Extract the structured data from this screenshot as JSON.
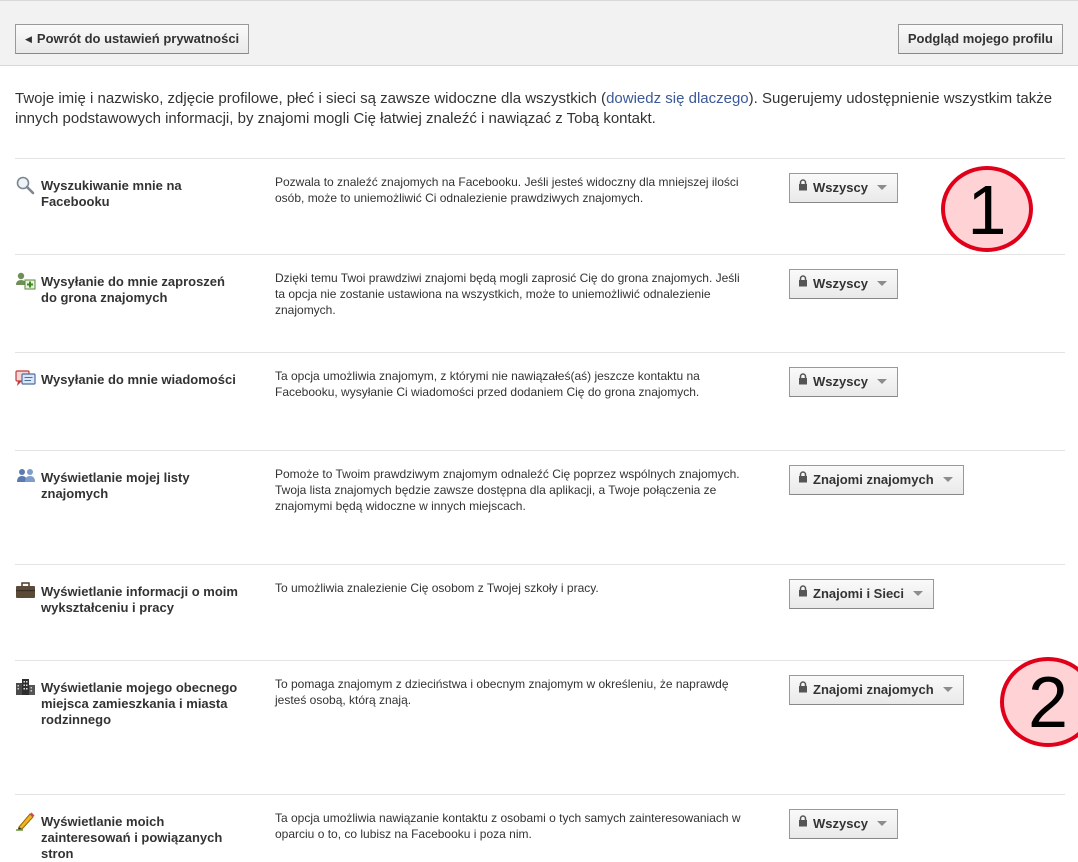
{
  "topbar": {
    "back_label": "Powrót do ustawień prywatności",
    "preview_label": "Podgląd mojego profilu"
  },
  "intro": {
    "text_before": "Twoje imię i nazwisko, zdjęcie profilowe, płeć i sieci są zawsze widoczne dla wszystkich (",
    "link": "dowiedz się dlaczego",
    "text_after": "). Sugerujemy udostępnienie wszystkim także innych podstawowych informacji, by znajomi mogli Cię łatwiej znaleźć i nawiązać z Tobą kontakt."
  },
  "settings": [
    {
      "icon": "magnifier-icon",
      "label": "Wyszukiwanie mnie na Facebooku",
      "description": "Pozwala to znaleźć znajomych na Facebooku. Jeśli jesteś widoczny dla mniejszej ilości osób, może to uniemożliwić Ci odnalezienie prawdziwych znajomych.",
      "value": "Wszyscy"
    },
    {
      "icon": "add-friend-icon",
      "label": "Wysyłanie do mnie zaproszeń do grona znajomych",
      "description": "Dzięki temu Twoi prawdziwi znajomi będą mogli zaprosić Cię do grona znajomych. Jeśli ta opcja nie zostanie ustawiona na wszystkich, może to uniemożliwić odnalezienie znajomych.",
      "value": "Wszyscy"
    },
    {
      "icon": "message-icon",
      "label": "Wysyłanie do mnie wiadomości",
      "description": "Ta opcja umożliwia znajomym, z którymi nie nawiązałeś(aś) jeszcze kontaktu na Facebooku, wysyłanie Ci wiadomości przed dodaniem Cię do grona znajomych.",
      "value": "Wszyscy"
    },
    {
      "icon": "friends-list-icon",
      "label": "Wyświetlanie mojej listy znajomych",
      "description": "Pomoże to Twoim prawdziwym znajomym odnaleźć Cię poprzez wspólnych znajomych. Twoja lista znajomych będzie zawsze dostępna dla aplikacji, a Twoje połączenia ze znajomymi będą widoczne w innych miejscach.",
      "value": "Znajomi znajomych"
    },
    {
      "icon": "briefcase-icon",
      "label": "Wyświetlanie informacji o moim wykształceniu i pracy",
      "description": "To umożliwia znalezienie Cię osobom z Twojej szkoły i pracy.",
      "value": "Znajomi i Sieci"
    },
    {
      "icon": "city-icon",
      "label": "Wyświetlanie mojego obecnego miejsca zamieszkania i miasta rodzinnego",
      "description": "To pomaga znajomym z dzieciństwa i obecnym znajomym w określeniu, że naprawdę jesteś osobą, którą znają.",
      "value": "Znajomi znajomych"
    },
    {
      "icon": "pencil-icon",
      "label": "Wyświetlanie moich zainteresowań i powiązanych stron",
      "description": "Ta opcja umożliwia nawiązanie kontaktu z osobami o tych samych zainteresowaniach w oparciu o to, co lubisz na Facebooku i poza nim.",
      "value": "Wszyscy"
    }
  ],
  "annotations": [
    "1",
    "2"
  ],
  "colors": {
    "link": "#3b5998",
    "annotation_border": "#e0001a",
    "annotation_fill": "#ffd3d6"
  }
}
